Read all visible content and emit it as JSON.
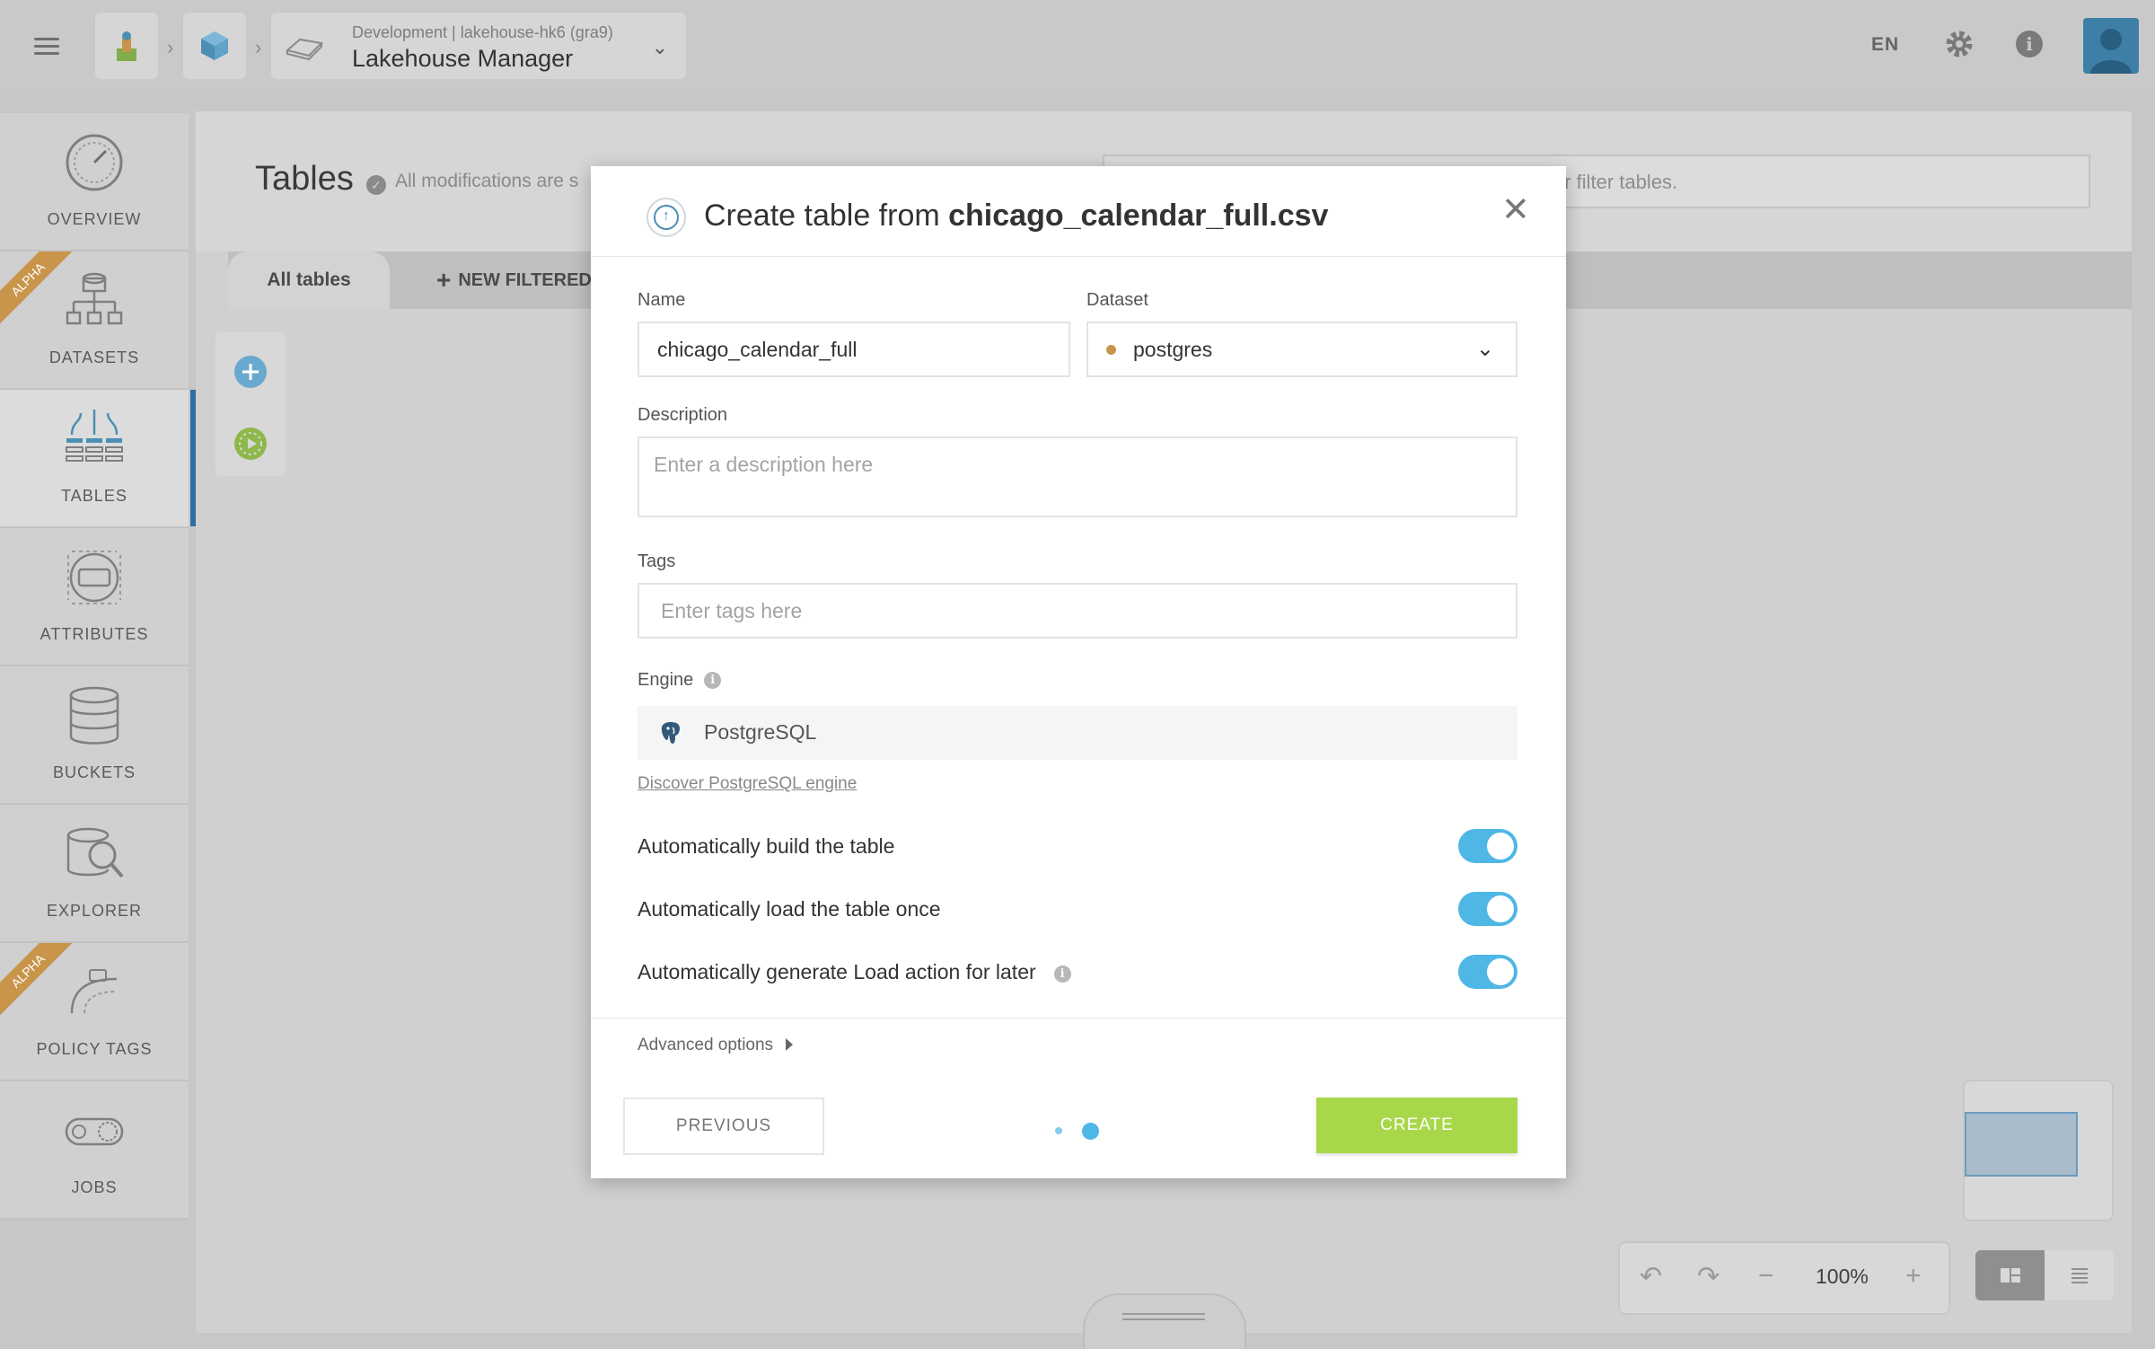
{
  "header": {
    "breadcrumb_subtitle": "Development | lakehouse-hk6 (gra9)",
    "breadcrumb_title": "Lakehouse Manager",
    "language": "EN"
  },
  "sidebar": {
    "items": [
      {
        "label": "OVERVIEW"
      },
      {
        "label": "DATASETS",
        "badge": "ALPHA"
      },
      {
        "label": "TABLES"
      },
      {
        "label": "ATTRIBUTES"
      },
      {
        "label": "BUCKETS"
      },
      {
        "label": "EXPLORER"
      },
      {
        "label": "POLICY TAGS",
        "badge": "ALPHA"
      },
      {
        "label": "JOBS"
      }
    ]
  },
  "page": {
    "title": "Tables",
    "status": "All modifications are s",
    "search_placeholder": "or filter tables.",
    "tabs": [
      "All tables",
      "NEW FILTERED VI"
    ],
    "zoom": "100%"
  },
  "modal": {
    "title_prefix": "Create table from ",
    "title_file": "chicago_calendar_full.csv",
    "name_label": "Name",
    "name_value": "chicago_calendar_full",
    "dataset_label": "Dataset",
    "dataset_value": "postgres",
    "description_label": "Description",
    "description_placeholder": "Enter a description here",
    "tags_label": "Tags",
    "tags_placeholder": "Enter tags here",
    "engine_label": "Engine",
    "engine_value": "PostgreSQL",
    "discover_link": "Discover PostgreSQL engine",
    "toggles": [
      {
        "label": "Automatically build the table",
        "on": true
      },
      {
        "label": "Automatically load the table once",
        "on": true
      },
      {
        "label": "Automatically generate Load action for later",
        "on": true
      }
    ],
    "advanced_label": "Advanced options",
    "previous_label": "PREVIOUS",
    "create_label": "CREATE",
    "step_current": 2,
    "step_total": 2
  },
  "colors": {
    "accent_blue": "#4eb7e5",
    "create_green": "#a8d84a",
    "dataset_dot": "#c8954a"
  }
}
